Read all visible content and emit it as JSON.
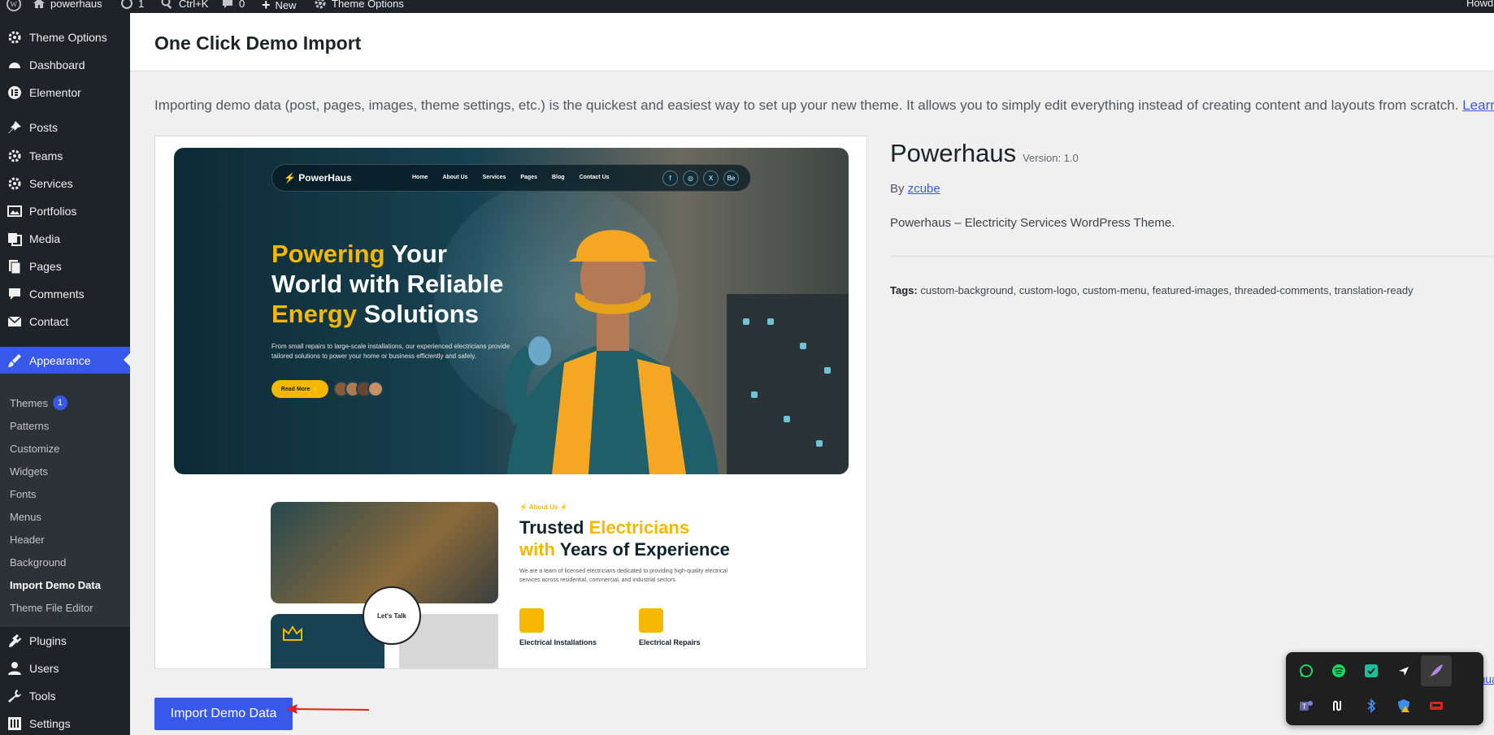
{
  "adminbar": {
    "site_name": "powerhaus",
    "updates_count": "1",
    "search_shortcut": "Ctrl+K",
    "comments_count": "0",
    "new_label": "New",
    "theme_options_label": "Theme Options",
    "howdy": "Howd"
  },
  "sidebar": {
    "items": [
      {
        "label": "Theme Options",
        "icon": "gear-icon"
      },
      {
        "label": "Dashboard",
        "icon": "dashboard-icon"
      },
      {
        "label": "Elementor",
        "icon": "elementor-icon"
      },
      {
        "label": "Posts",
        "icon": "pin-icon"
      },
      {
        "label": "Teams",
        "icon": "gear-icon"
      },
      {
        "label": "Services",
        "icon": "gear-icon"
      },
      {
        "label": "Portfolios",
        "icon": "portfolio-icon"
      },
      {
        "label": "Media",
        "icon": "media-icon"
      },
      {
        "label": "Pages",
        "icon": "pages-icon"
      },
      {
        "label": "Comments",
        "icon": "comment-icon"
      },
      {
        "label": "Contact",
        "icon": "mail-icon"
      },
      {
        "label": "Appearance",
        "icon": "brush-icon"
      },
      {
        "label": "Plugins",
        "icon": "plugin-icon"
      },
      {
        "label": "Users",
        "icon": "user-icon"
      },
      {
        "label": "Tools",
        "icon": "wrench-icon"
      },
      {
        "label": "Settings",
        "icon": "settings-icon"
      }
    ],
    "submenu": [
      {
        "label": "Themes",
        "badge": "1"
      },
      {
        "label": "Patterns"
      },
      {
        "label": "Customize"
      },
      {
        "label": "Widgets"
      },
      {
        "label": "Fonts"
      },
      {
        "label": "Menus"
      },
      {
        "label": "Header"
      },
      {
        "label": "Background"
      },
      {
        "label": "Import Demo Data"
      },
      {
        "label": "Theme File Editor"
      }
    ]
  },
  "page": {
    "title": "One Click Demo Import",
    "intro": "Importing demo data (post, pages, images, theme settings, etc.) is the quickest and easiest way to set up your new theme. It allows you to simply edit everything instead of creating content and layouts from scratch.",
    "intro_link": "Learn",
    "import_button": "Import Demo Data",
    "manual_link": "o Manua"
  },
  "preview": {
    "logo": "PowerHaus",
    "nav": [
      "Home",
      "About Us",
      "Services",
      "Pages",
      "Blog",
      "Contact Us"
    ],
    "social": [
      "f",
      "◎",
      "X",
      "Be"
    ],
    "hero_title_hl1": "Powering",
    "hero_title_1": " Your",
    "hero_title_2": "World with Reliable",
    "hero_title_hl2": "Energy",
    "hero_title_3": " Solutions",
    "hero_desc": "From small repairs to large-scale installations, our experienced electricians provide tailored solutions to power your home or business efficiently and safely.",
    "read_more": "Read More ⚡",
    "about_tag": "⚡ About Us ⚡",
    "about_title_1": "Trusted ",
    "about_title_hl1": "Electricians",
    "about_title_hl2": "with",
    "about_title_2": " Years of Experience",
    "about_desc": "We are a team of licensed electricians dedicated to providing high-quality electrical services across residential, commercial, and industrial sectors.",
    "badge_text": "Let's Talk",
    "feature_1": "Electrical Installations",
    "feature_2": "Electrical Repairs"
  },
  "theme": {
    "name": "Powerhaus",
    "version": "Version: 1.0",
    "by_label": "By",
    "author": "zcube",
    "description": "Powerhaus – Electricity Services WordPress Theme.",
    "tags_label": "Tags:",
    "tags": "custom-background, custom-logo, custom-menu, featured-images, threaded-comments, translation-ready"
  },
  "tray": {
    "icons": [
      "whatsapp-icon",
      "spotify-icon",
      "app-icon",
      "cursor-icon",
      "feather-icon",
      "teams-icon",
      "notion-icon",
      "bluetooth-icon",
      "security-icon",
      "speaker-icon"
    ]
  },
  "colors": {
    "accent": "#3858e9",
    "admin_dark": "#1d2327",
    "brand_yellow": "#f5b800"
  }
}
